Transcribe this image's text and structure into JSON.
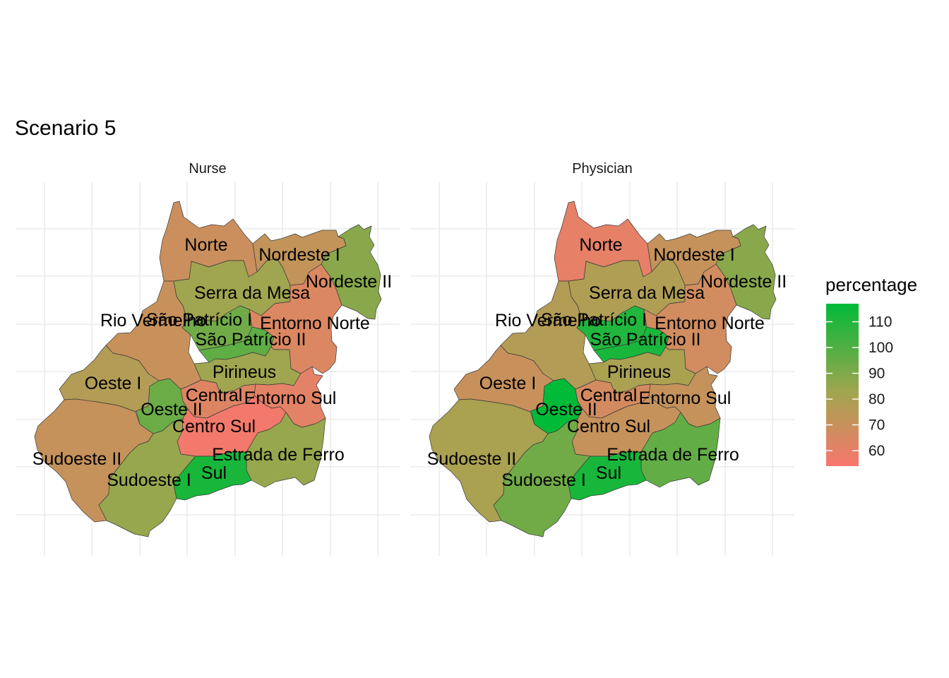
{
  "title": "Scenario 5",
  "legend": {
    "title": "percentage",
    "ticks": [
      110,
      100,
      90,
      80,
      70,
      60
    ],
    "min": 54,
    "max": 117,
    "low_color": "#f8766d",
    "mid_color": "#a3a54f",
    "high_color": "#00ba38"
  },
  "panels": [
    {
      "name": "Nurse",
      "regions": [
        {
          "name": "Norte",
          "value": 69
        },
        {
          "name": "Nordeste I",
          "value": 72
        },
        {
          "name": "Nordeste II",
          "value": 88
        },
        {
          "name": "Serra da Mesa",
          "value": 83
        },
        {
          "name": "Rio Vermelho",
          "value": 70
        },
        {
          "name": "São Patrício I",
          "value": 93
        },
        {
          "name": "São Patrício II",
          "value": 97
        },
        {
          "name": "Entorno Norte",
          "value": 64
        },
        {
          "name": "Oeste I",
          "value": 77
        },
        {
          "name": "Oeste II",
          "value": 94
        },
        {
          "name": "Pirineus",
          "value": 83
        },
        {
          "name": "Central",
          "value": 63
        },
        {
          "name": "Entorno Sul",
          "value": 61
        },
        {
          "name": "Centro Sul",
          "value": 56
        },
        {
          "name": "Sudoeste II",
          "value": 71
        },
        {
          "name": "Sudoeste I",
          "value": 85
        },
        {
          "name": "Estrada de Ferro",
          "value": 85
        },
        {
          "name": "Sul",
          "value": 112
        }
      ]
    },
    {
      "name": "Physician",
      "regions": [
        {
          "name": "Norte",
          "value": 60
        },
        {
          "name": "Nordeste I",
          "value": 71
        },
        {
          "name": "Nordeste II",
          "value": 88
        },
        {
          "name": "Serra da Mesa",
          "value": 78
        },
        {
          "name": "Rio Vermelho",
          "value": 77
        },
        {
          "name": "São Patrício I",
          "value": 110
        },
        {
          "name": "São Patrício II",
          "value": 112
        },
        {
          "name": "Entorno Norte",
          "value": 67
        },
        {
          "name": "Oeste I",
          "value": 70
        },
        {
          "name": "Oeste II",
          "value": 117
        },
        {
          "name": "Pirineus",
          "value": 80
        },
        {
          "name": "Central",
          "value": 66
        },
        {
          "name": "Entorno Sul",
          "value": 71
        },
        {
          "name": "Centro Sul",
          "value": 71
        },
        {
          "name": "Sudoeste II",
          "value": 80
        },
        {
          "name": "Sudoeste I",
          "value": 93
        },
        {
          "name": "Estrada de Ferro",
          "value": 96
        },
        {
          "name": "Sul",
          "value": 112
        }
      ]
    }
  ]
}
